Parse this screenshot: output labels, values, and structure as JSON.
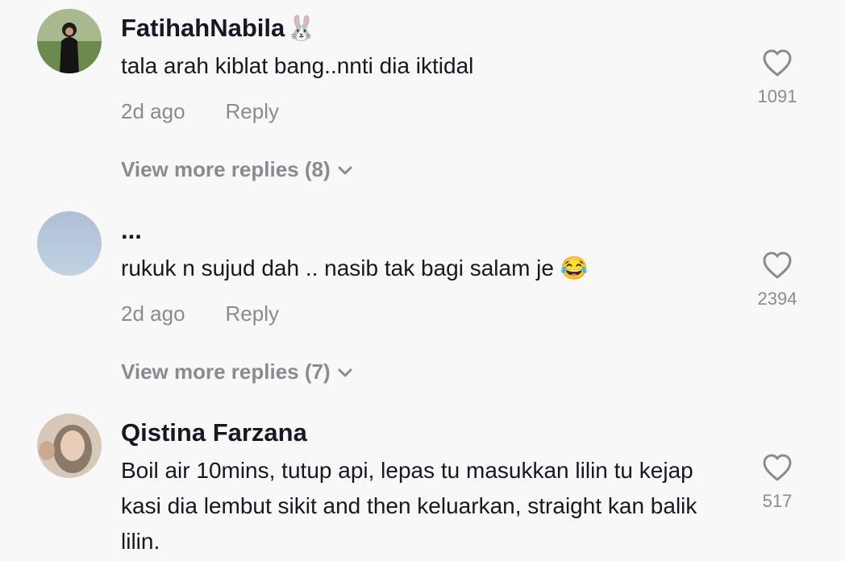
{
  "comments": [
    {
      "username": "FatihahNabila",
      "username_emoji": "🐰",
      "text": "tala arah kiblat bang..nnti dia iktidal",
      "time": "2d ago",
      "reply_label": "Reply",
      "likes": "1091",
      "more_replies": "View more replies (8)",
      "avatar_icon": "user-avatar-photo"
    },
    {
      "username": "...",
      "text": "rukuk n sujud dah .. nasib tak bagi salam je 😂",
      "time": "2d ago",
      "reply_label": "Reply",
      "likes": "2394",
      "more_replies": "View more replies (7)",
      "avatar_icon": "sky-avatar"
    },
    {
      "username": "Qistina Farzana",
      "text": "Boil air 10mins, tutup api, lepas tu masukkan lilin tu kejap kasi dia lembut sikit and then keluarkan, straight kan balik lilin.",
      "likes": "517",
      "avatar_icon": "user-avatar-photo"
    }
  ],
  "colors": {
    "background": "#f8f8f8",
    "primary_text": "#161823",
    "secondary_text": "#8a8b91"
  }
}
